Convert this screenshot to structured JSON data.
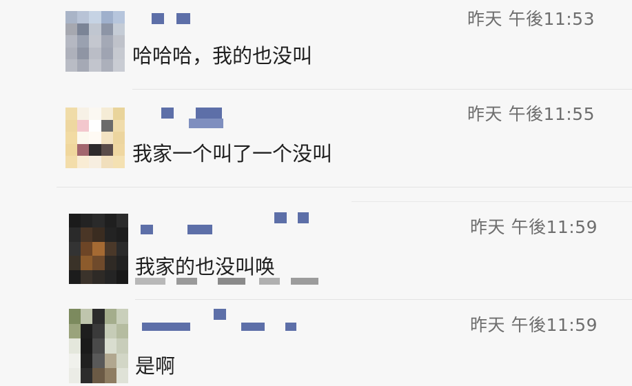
{
  "comments": [
    {
      "time": "昨天 午後11:53",
      "text": "哈哈哈，我的也没叫"
    },
    {
      "time": "昨天 午後11:55",
      "text": "我家一个叫了一个没叫"
    },
    {
      "time": "昨天 午後11:59",
      "text": "我家的也没叫唤"
    },
    {
      "time": "昨天 午後11:59",
      "text": "是啊"
    }
  ],
  "colors": {
    "background": "#f7f7f7",
    "name_blur": "#5d6fa8",
    "time_text": "#6e6e6e",
    "body_text": "#1f1f1f",
    "divider": "#e3e3e3"
  }
}
